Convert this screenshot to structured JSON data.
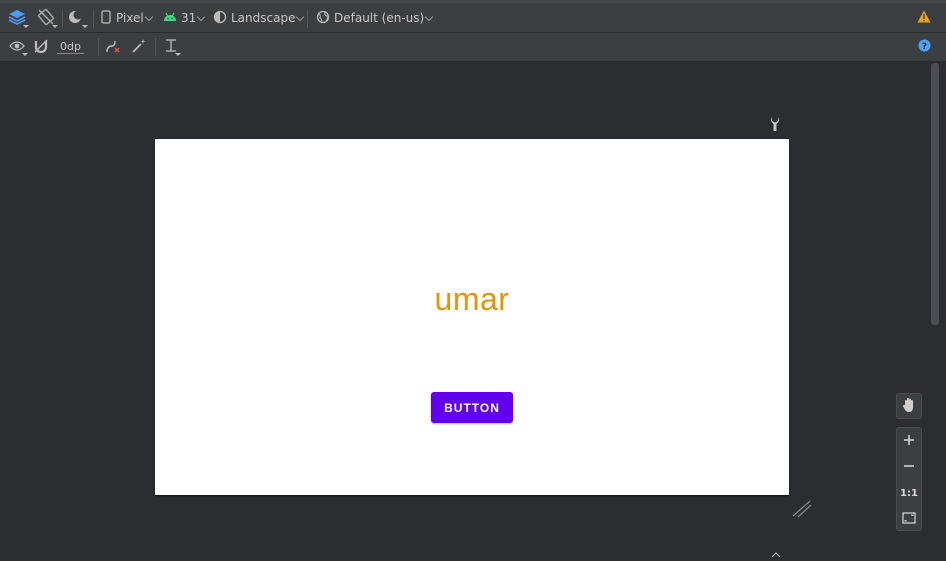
{
  "toolbar": {
    "device": "Pixel",
    "api_level": "31",
    "orientation": "Landscape",
    "locale": "Default (en-us)",
    "margin_value": "0dp"
  },
  "layout": {
    "text_view": "umar",
    "button_label": "BUTTON"
  },
  "zoom": {
    "actual_size_label": "1:1"
  },
  "colors": {
    "panel": "#3c3f41",
    "canvas_bg": "#2b2d30",
    "text_color": "#e5930a",
    "button_bg": "#6200ee",
    "android_green": "#3ddc84",
    "warning": "#f0a30a",
    "help": "#4aa3ff"
  },
  "icons": [
    "layers-icon",
    "rotate-off-icon",
    "night-mode-icon",
    "phone-icon",
    "android-icon",
    "theme-icon",
    "globe-icon",
    "warning-icon",
    "eye-icon",
    "magnet-icon",
    "clear-constraints-icon",
    "magic-wand-icon",
    "guidelines-icon",
    "help-icon",
    "wrench-icon",
    "pan-hand-icon",
    "zoom-in-icon",
    "zoom-out-icon",
    "zoom-fit-icon",
    "resize-handle-icon"
  ]
}
